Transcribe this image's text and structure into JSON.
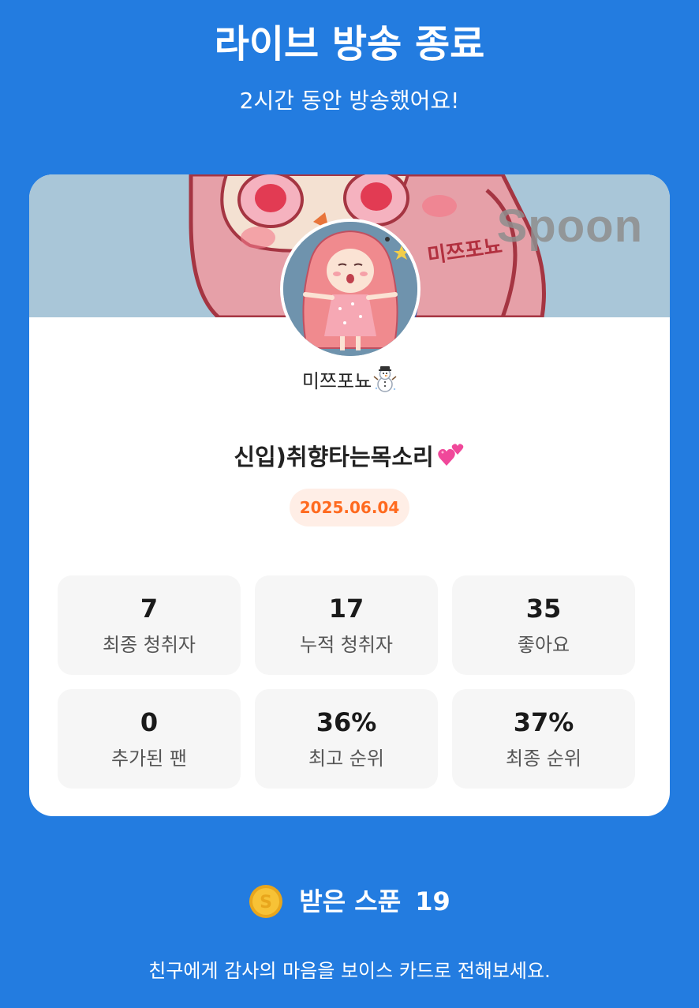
{
  "header": {
    "title": "라이브 방송 종료",
    "subtitle": "2시간 동안 방송했어요!"
  },
  "card": {
    "brand_watermark": "Spoon",
    "banner_sign": "미쯔포뇨",
    "nickname": "미쯔포뇨",
    "nickname_emoji": "snowman-icon",
    "room_title": "신입)취향타는목소리",
    "room_title_emoji": "two-hearts-icon",
    "date": "2025.06.04",
    "stats": [
      {
        "value": "7",
        "label": "최종 청취자"
      },
      {
        "value": "17",
        "label": "누적 청취자"
      },
      {
        "value": "35",
        "label": "좋아요"
      },
      {
        "value": "0",
        "label": "추가된 팬"
      },
      {
        "value": "36%",
        "label": "최고 순위"
      },
      {
        "value": "37%",
        "label": "최종 순위"
      }
    ]
  },
  "spoons": {
    "label": "받은 스푼",
    "count": "19",
    "icon": "spoon-coin-icon"
  },
  "footer": {
    "text": "친구에게 감사의 마음을 보이스 카드로 전해보세요."
  },
  "colors": {
    "background": "#237CE0",
    "accent_orange": "#FF6A1F",
    "pill_bg": "#FFEEE6",
    "stat_bg": "#F6F6F6"
  }
}
